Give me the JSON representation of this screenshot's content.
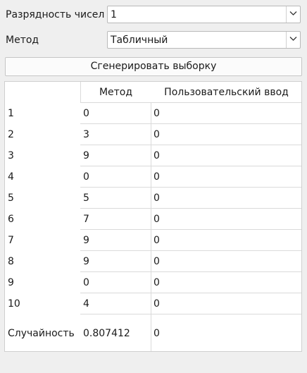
{
  "form": {
    "bits_label": "Разрядность чисел",
    "bits_value": "1",
    "method_label": "Метод",
    "method_value": "Табличный",
    "generate_label": "Сгенерировать выборку"
  },
  "table": {
    "headers": {
      "method": "Метод",
      "user_input": "Пользовательский ввод"
    },
    "rows": [
      {
        "label": "1",
        "method": "0",
        "user": "0"
      },
      {
        "label": "2",
        "method": "3",
        "user": "0"
      },
      {
        "label": "3",
        "method": "9",
        "user": "0"
      },
      {
        "label": "4",
        "method": "0",
        "user": "0"
      },
      {
        "label": "5",
        "method": "5",
        "user": "0"
      },
      {
        "label": "6",
        "method": "7",
        "user": "0"
      },
      {
        "label": "7",
        "method": "9",
        "user": "0"
      },
      {
        "label": "8",
        "method": "9",
        "user": "0"
      },
      {
        "label": "9",
        "method": "0",
        "user": "0"
      },
      {
        "label": "10",
        "method": "4",
        "user": "0"
      }
    ],
    "randomness": {
      "label": "Случайность",
      "method": "0.807412",
      "user": "0"
    }
  },
  "icons": {
    "dropdown": "chevron-down-icon"
  }
}
